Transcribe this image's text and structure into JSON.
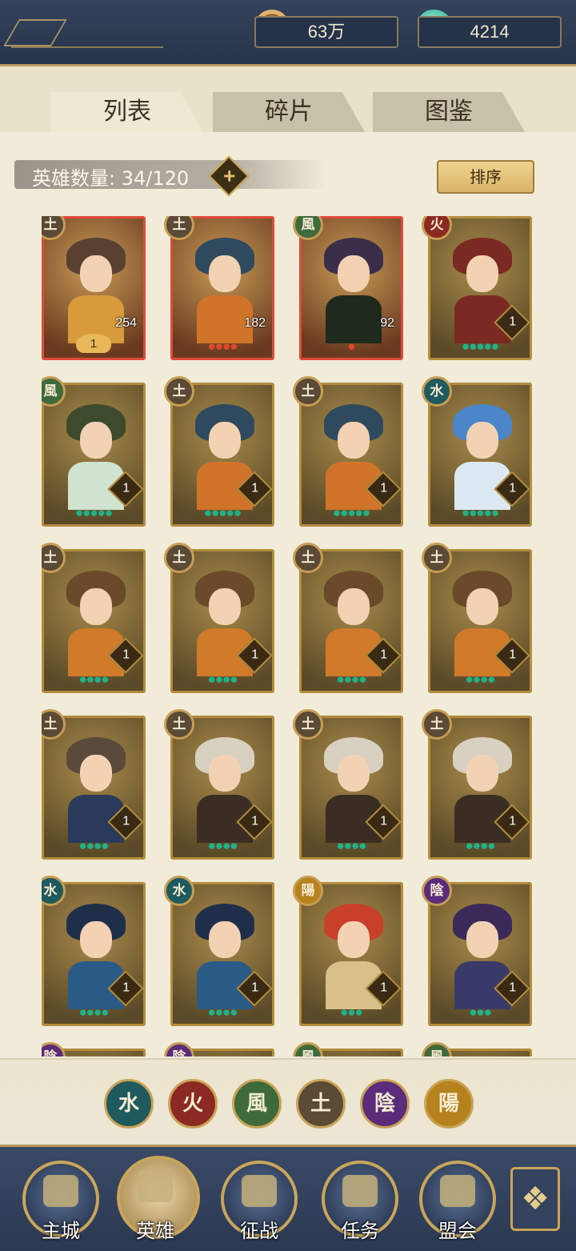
{
  "currency": {
    "coins": {
      "value": "63万",
      "icon": "copper-coin-icon"
    },
    "jade": {
      "value": "4214",
      "icon": "jade-icon"
    },
    "plus_symbol": "+"
  },
  "tabs": [
    {
      "label": "列表",
      "active": true
    },
    {
      "label": "碎片",
      "active": false
    },
    {
      "label": "图鉴",
      "active": false
    }
  ],
  "hero_count": {
    "label": "英雄数量: 34/120",
    "plus_symbol": "+"
  },
  "sort_label": "排序",
  "elements": {
    "earth": {
      "glyph": "土",
      "color": "#5a4a36"
    },
    "wind": {
      "glyph": "風",
      "color": "#3f6a3c"
    },
    "fire": {
      "glyph": "火",
      "color": "#8a2a22"
    },
    "water": {
      "glyph": "水",
      "color": "#1f5a5e"
    },
    "yang": {
      "glyph": "陽",
      "color": "#b5821e"
    },
    "yin": {
      "glyph": "陰",
      "color": "#5a2c7a"
    }
  },
  "heroes": [
    {
      "element": "earth",
      "glyph": "土",
      "stars": "●",
      "level": "1",
      "shards": "254",
      "frame": "red"
    },
    {
      "element": "earth",
      "glyph": "土",
      "stars": "●●●●",
      "shards": "182",
      "frame": "red"
    },
    {
      "element": "wind",
      "glyph": "風",
      "stars": "●",
      "shards": "92",
      "frame": "red"
    },
    {
      "element": "fire",
      "glyph": "火",
      "stars": "●●●●●",
      "level": "1",
      "frame": "gold"
    },
    {
      "element": "wind",
      "glyph": "風",
      "stars": "●●●●●",
      "level": "1",
      "frame": "gold"
    },
    {
      "element": "earth",
      "glyph": "土",
      "stars": "●●●●●",
      "level": "1",
      "frame": "gold"
    },
    {
      "element": "earth",
      "glyph": "土",
      "stars": "●●●●●",
      "level": "1",
      "frame": "gold"
    },
    {
      "element": "water",
      "glyph": "水",
      "stars": "●●●●●",
      "level": "1",
      "frame": "gold"
    },
    {
      "element": "earth",
      "glyph": "土",
      "stars": "●●●●",
      "level": "1",
      "frame": "gold"
    },
    {
      "element": "earth",
      "glyph": "土",
      "stars": "●●●●",
      "level": "1",
      "frame": "gold"
    },
    {
      "element": "earth",
      "glyph": "土",
      "stars": "●●●●",
      "level": "1",
      "frame": "gold"
    },
    {
      "element": "earth",
      "glyph": "土",
      "stars": "●●●●",
      "level": "1",
      "frame": "gold"
    },
    {
      "element": "earth",
      "glyph": "土",
      "stars": "●●●●",
      "level": "1",
      "frame": "gold"
    },
    {
      "element": "earth",
      "glyph": "土",
      "stars": "●●●●",
      "level": "1",
      "frame": "gold"
    },
    {
      "element": "earth",
      "glyph": "土",
      "stars": "●●●●",
      "level": "1",
      "frame": "gold"
    },
    {
      "element": "earth",
      "glyph": "土",
      "stars": "●●●●",
      "level": "1",
      "frame": "gold"
    },
    {
      "element": "water",
      "glyph": "水",
      "stars": "●●●●",
      "level": "1",
      "frame": "gold"
    },
    {
      "element": "water",
      "glyph": "水",
      "stars": "●●●●",
      "level": "1",
      "frame": "gold"
    },
    {
      "element": "yang",
      "glyph": "陽",
      "stars": "●●●",
      "level": "1",
      "frame": "gold"
    },
    {
      "element": "yin",
      "glyph": "陰",
      "stars": "●●●",
      "level": "1",
      "frame": "gold"
    },
    {
      "element": "yin",
      "glyph": "陰",
      "stars": "",
      "frame": "gold"
    },
    {
      "element": "yin",
      "glyph": "陰",
      "stars": "",
      "frame": "gold"
    },
    {
      "element": "wind",
      "glyph": "風",
      "stars": "",
      "frame": "gold"
    },
    {
      "element": "wind",
      "glyph": "風",
      "stars": "",
      "frame": "gold"
    }
  ],
  "filters": [
    {
      "element": "water",
      "glyph": "水"
    },
    {
      "element": "fire",
      "glyph": "火"
    },
    {
      "element": "wind",
      "glyph": "風"
    },
    {
      "element": "earth",
      "glyph": "土"
    },
    {
      "element": "yin",
      "glyph": "陰"
    },
    {
      "element": "yang",
      "glyph": "陽"
    }
  ],
  "nav": [
    {
      "label": "主城",
      "icon": "city-icon",
      "active": false
    },
    {
      "label": "英雄",
      "icon": "hero-icon",
      "active": true
    },
    {
      "label": "征战",
      "icon": "battle-icon",
      "active": false
    },
    {
      "label": "任务",
      "icon": "quest-icon",
      "active": false
    },
    {
      "label": "盟会",
      "icon": "guild-icon",
      "active": false
    }
  ],
  "more_icon": "more-menu-icon",
  "more_glyph": "❖"
}
